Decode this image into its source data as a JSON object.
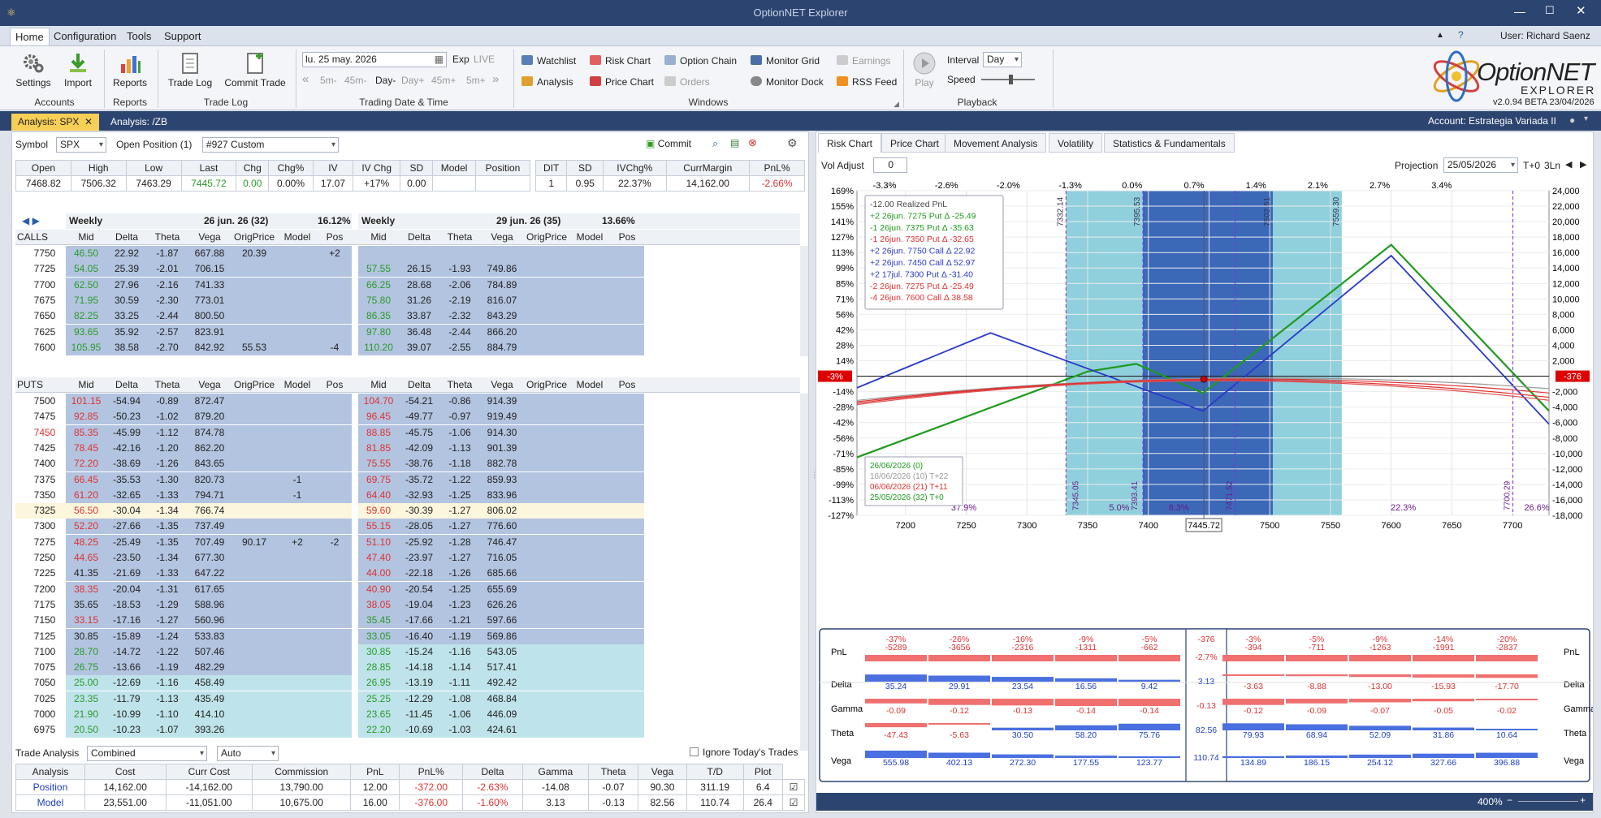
{
  "app": {
    "title": "OptionNET Explorer",
    "user": "User: Richard Saenz",
    "version": "v2.0.94 BETA 23/04/2026",
    "logo_main": "OptionNET",
    "logo_sub": "EXPLORER"
  },
  "menu": [
    "Home",
    "Configuration",
    "Tools",
    "Support"
  ],
  "ribbon": {
    "accounts": {
      "label": "Accounts",
      "buttons": [
        "Settings",
        "Import"
      ]
    },
    "reports": {
      "label": "Reports",
      "buttons": [
        "Reports"
      ]
    },
    "tradelog": {
      "label": "Trade Log",
      "buttons": [
        "Trade Log",
        "Commit Trade"
      ]
    },
    "trading": {
      "label": "Trading Date & Time",
      "date": "lu. 25 may. 2026",
      "exp": "Exp",
      "live": "LIVE",
      "steps": [
        "5m-",
        "45m-",
        "Day-",
        "Day+",
        "45m+",
        "5m+"
      ]
    },
    "windows": {
      "label": "Windows",
      "items": [
        "Watchlist",
        "Risk Chart",
        "Option Chain",
        "Monitor Grid",
        "Earnings",
        "Analysis",
        "Price Chart",
        "Orders",
        "Monitor Dock",
        "RSS Feed"
      ]
    },
    "playback": {
      "label": "Playback",
      "play": "Play",
      "interval_label": "Interval",
      "interval": "Day",
      "speed_label": "Speed"
    }
  },
  "doctabs": [
    "Analysis: SPX",
    "Analysis: /ZB"
  ],
  "account": "Account: Estrategia Variada II",
  "left": {
    "symbol_label": "Symbol",
    "symbol": "SPX",
    "open_pos_label": "Open Position (1)",
    "position": "#927 Custom",
    "commit": "Commit",
    "quote_headers": [
      "Open",
      "High",
      "Low",
      "Last",
      "Chg",
      "Chg%",
      "IV",
      "IV Chg",
      "SD",
      "Model",
      "Position"
    ],
    "quote_values": [
      "7468.82",
      "7506.32",
      "7463.29",
      "7445.72",
      "0.00",
      "0.00%",
      "17.07",
      "+17%",
      "0.00",
      "",
      ""
    ],
    "pos_headers": [
      "DIT",
      "SD",
      "IVChg%",
      "CurrMargin",
      "PnL%"
    ],
    "pos_values": [
      "1",
      "0.95",
      "22.37%",
      "14,162.00",
      "-2.66%"
    ],
    "exp1": {
      "name": "Weekly",
      "date": "26 jun. 26 (32)",
      "iv": "16.12%"
    },
    "exp2": {
      "name": "Weekly",
      "date": "29 jun. 26 (35)",
      "iv": "13.66%"
    },
    "chain_cols": [
      "Mid",
      "Delta",
      "Theta",
      "Vega",
      "OrigPrice",
      "Model",
      "Pos"
    ],
    "calls_label": "CALLS",
    "puts_label": "PUTS",
    "calls": [
      [
        "7750",
        "46.50",
        "22.92",
        "-1.87",
        "667.88",
        "20.39",
        "",
        "+2",
        "",
        "",
        "",
        "",
        "",
        "",
        ""
      ],
      [
        "7725",
        "54.05",
        "25.39",
        "-2.01",
        "706.15",
        "",
        "",
        "",
        "57.55",
        "26.15",
        "-1.93",
        "749.86",
        "",
        "",
        ""
      ],
      [
        "7700",
        "62.50",
        "27.96",
        "-2.16",
        "741.33",
        "",
        "",
        "",
        "66.25",
        "28.68",
        "-2.06",
        "784.89",
        "",
        "",
        ""
      ],
      [
        "7675",
        "71.95",
        "30.59",
        "-2.30",
        "773.01",
        "",
        "",
        "",
        "75.80",
        "31.26",
        "-2.19",
        "816.07",
        "",
        "",
        ""
      ],
      [
        "7650",
        "82.25",
        "33.25",
        "-2.44",
        "800.50",
        "",
        "",
        "",
        "86.35",
        "33.87",
        "-2.32",
        "843.29",
        "",
        "",
        ""
      ],
      [
        "7625",
        "93.65",
        "35.92",
        "-2.57",
        "823.91",
        "",
        "",
        "",
        "97.80",
        "36.48",
        "-2.44",
        "866.20",
        "",
        "",
        ""
      ],
      [
        "7600",
        "105.95",
        "38.58",
        "-2.70",
        "842.92",
        "55.53",
        "",
        "-4",
        "110.20",
        "39.07",
        "-2.55",
        "884.79",
        "",
        "",
        ""
      ]
    ],
    "puts": [
      [
        "7500",
        "101.15",
        "-54.94",
        "-0.89",
        "872.47",
        "",
        "",
        "",
        "104.70",
        "-54.21",
        "-0.86",
        "914.39",
        "",
        "",
        ""
      ],
      [
        "7475",
        "92.85",
        "-50.23",
        "-1.02",
        "879.20",
        "",
        "",
        "",
        "96.45",
        "-49.77",
        "-0.97",
        "919.49",
        "",
        "",
        ""
      ],
      [
        "7450",
        "85.35",
        "-45.99",
        "-1.12",
        "874.78",
        "",
        "",
        "",
        "88.85",
        "-45.75",
        "-1.06",
        "914.30",
        "",
        "",
        ""
      ],
      [
        "7425",
        "78.45",
        "-42.16",
        "-1.20",
        "862.20",
        "",
        "",
        "",
        "81.85",
        "-42.09",
        "-1.13",
        "901.39",
        "",
        "",
        ""
      ],
      [
        "7400",
        "72.20",
        "-38.69",
        "-1.26",
        "843.65",
        "",
        "",
        "",
        "75.55",
        "-38.76",
        "-1.18",
        "882.78",
        "",
        "",
        ""
      ],
      [
        "7375",
        "66.45",
        "-35.53",
        "-1.30",
        "820.73",
        "",
        "-1",
        "",
        "69.75",
        "-35.72",
        "-1.22",
        "859.93",
        "",
        "",
        ""
      ],
      [
        "7350",
        "61.20",
        "-32.65",
        "-1.33",
        "794.71",
        "",
        "-1",
        "",
        "64.40",
        "-32.93",
        "-1.25",
        "833.96",
        "",
        "",
        ""
      ],
      [
        "7325",
        "56.50",
        "-30.04",
        "-1.34",
        "766.74",
        "",
        "",
        "",
        "59.60",
        "-30.39",
        "-1.27",
        "806.02",
        "",
        "",
        ""
      ],
      [
        "7300",
        "52.20",
        "-27.66",
        "-1.35",
        "737.49",
        "",
        "",
        "",
        "55.15",
        "-28.05",
        "-1.27",
        "776.60",
        "",
        "",
        ""
      ],
      [
        "7275",
        "48.25",
        "-25.49",
        "-1.35",
        "707.49",
        "90.17",
        "+2",
        "-2",
        "51.10",
        "-25.92",
        "-1.28",
        "746.47",
        "",
        "",
        ""
      ],
      [
        "7250",
        "44.65",
        "-23.50",
        "-1.34",
        "677.30",
        "",
        "",
        "",
        "47.40",
        "-23.97",
        "-1.27",
        "716.05",
        "",
        "",
        ""
      ],
      [
        "7225",
        "41.35",
        "-21.69",
        "-1.33",
        "647.22",
        "",
        "",
        "",
        "44.00",
        "-22.18",
        "-1.26",
        "685.66",
        "",
        "",
        ""
      ],
      [
        "7200",
        "38.35",
        "-20.04",
        "-1.31",
        "617.65",
        "",
        "",
        "",
        "40.90",
        "-20.54",
        "-1.25",
        "655.69",
        "",
        "",
        ""
      ],
      [
        "7175",
        "35.65",
        "-18.53",
        "-1.29",
        "588.96",
        "",
        "",
        "",
        "38.05",
        "-19.04",
        "-1.23",
        "626.26",
        "",
        "",
        ""
      ],
      [
        "7150",
        "33.15",
        "-17.16",
        "-1.27",
        "560.96",
        "",
        "",
        "",
        "35.45",
        "-17.66",
        "-1.21",
        "597.66",
        "",
        "",
        ""
      ],
      [
        "7125",
        "30.85",
        "-15.89",
        "-1.24",
        "533.83",
        "",
        "",
        "",
        "33.05",
        "-16.40",
        "-1.19",
        "569.86",
        "",
        "",
        ""
      ],
      [
        "7100",
        "28.70",
        "-14.72",
        "-1.22",
        "507.46",
        "",
        "",
        "",
        "30.85",
        "-15.24",
        "-1.16",
        "543.05",
        "",
        "",
        ""
      ],
      [
        "7075",
        "26.75",
        "-13.66",
        "-1.19",
        "482.29",
        "",
        "",
        "",
        "28.85",
        "-14.18",
        "-1.14",
        "517.41",
        "",
        "",
        ""
      ],
      [
        "7050",
        "25.00",
        "-12.69",
        "-1.16",
        "458.49",
        "",
        "",
        "",
        "26.95",
        "-13.19",
        "-1.11",
        "492.42",
        "",
        "",
        ""
      ],
      [
        "7025",
        "23.35",
        "-11.79",
        "-1.13",
        "435.49",
        "",
        "",
        "",
        "25.25",
        "-12.29",
        "-1.08",
        "468.84",
        "",
        "",
        ""
      ],
      [
        "7000",
        "21.90",
        "-10.99",
        "-1.10",
        "414.10",
        "",
        "",
        "",
        "23.65",
        "-11.45",
        "-1.06",
        "446.09",
        "",
        "",
        ""
      ],
      [
        "6975",
        "20.50",
        "-10.23",
        "-1.07",
        "393.26",
        "",
        "",
        "",
        "22.20",
        "-10.69",
        "-1.03",
        "424.61",
        "",
        "",
        ""
      ]
    ],
    "trade_analysis": {
      "label": "Trade Analysis",
      "mode": "Combined",
      "auto": "Auto",
      "ignore": "Ignore Today's Trades",
      "headers": [
        "Analysis",
        "Cost",
        "Curr Cost",
        "Commission",
        "PnL",
        "PnL%",
        "Delta",
        "Gamma",
        "Theta",
        "Vega",
        "T/D",
        "Plot"
      ],
      "rows": [
        [
          "Position",
          "14,162.00",
          "-14,162.00",
          "13,790.00",
          "12.00",
          "-372.00",
          "-2.63%",
          "-14.08",
          "-0.07",
          "90.30",
          "311.19",
          "6.4"
        ],
        [
          "Model",
          "23,551.00",
          "-11,051.00",
          "10,675.00",
          "16.00",
          "-376.00",
          "-1.60%",
          "3.13",
          "-0.13",
          "82.56",
          "110.74",
          "26.4"
        ]
      ]
    }
  },
  "right": {
    "tabs": [
      "Risk Chart",
      "Price Chart",
      "Movement Analysis",
      "Volatility",
      "Statistics & Fundamentals"
    ],
    "vol_adjust_label": "Vol Adjust",
    "vol_adjust": "0",
    "projection_label": "Projection",
    "projection": "25/05/2026",
    "t0": "T+0",
    "ln": "3Ln",
    "zoom": "400%",
    "legend": [
      "-12.00 Realized PnL",
      "+2 26jun. 7275 Put Δ  -25.49",
      "-1 26jun. 7375 Put Δ  -35.63",
      "-1 26jun. 7350 Put Δ  -32.65",
      "+2 26jun. 7750 Call Δ  22.92",
      "+2 26jun. 7450 Call Δ  52.97",
      "+2 17jul. 7300 Put Δ  -31.40",
      "-2 26jun. 7275 Put Δ  -25.49",
      "-4 26jun. 7600 Call Δ  38.58"
    ],
    "curve_legend": [
      "26/06/2026 (0)",
      "16/06/2026 (10) T+22",
      "06/06/2026 (21) T+11",
      "25/05/2026 (32) T+0"
    ],
    "pct_top": [
      "-3.3%",
      "-2.6%",
      "-2.0%",
      "-1.3%",
      "0.0%",
      "0.7%",
      "1.4%",
      "2.1%",
      "2.7%",
      "3.4%"
    ],
    "pct_left": [
      "169%",
      "155%",
      "141%",
      "127%",
      "113%",
      "99%",
      "85%",
      "71%",
      "56%",
      "42%",
      "28%",
      "14%",
      "-14%",
      "-28%",
      "-42%",
      "-56%",
      "-71%",
      "-85%",
      "-99%",
      "-113%",
      "-127%"
    ],
    "pnl_right": [
      "24,000",
      "22,000",
      "20,000",
      "18,000",
      "16,000",
      "14,000",
      "12,000",
      "10,000",
      "8,000",
      "6,000",
      "4,000",
      "2,000",
      "-2,000",
      "-4,000",
      "-6,000",
      "-8,000",
      "-10,000",
      "-12,000",
      "-14,000",
      "-16,000",
      "-18,000"
    ],
    "x_ticks": [
      "7200",
      "7250",
      "7300",
      "7350",
      "7400",
      "7450",
      "7500",
      "7550",
      "7600",
      "7650",
      "7700"
    ],
    "last": "7445.72",
    "cur_pct": "-3%",
    "cur_pnl": "-376",
    "vlines": [
      "7332.14",
      "7395.53",
      "7502.51",
      "7559.30",
      "7345.05",
      "7393.41",
      "7471.52",
      "7700.29"
    ],
    "zone_pct": [
      "37.9%",
      "5.0%",
      "8.3%",
      "22.3%",
      "26.6%"
    ],
    "greeks": {
      "pnl_pct": [
        "-37%",
        "-26%",
        "-16%",
        "-9%",
        "-5%",
        "-376",
        "-3%",
        "-5%",
        "-9%",
        "-14%",
        "-20%"
      ],
      "pnl": [
        "-5289",
        "-3656",
        "-2316",
        "-1311",
        "-662",
        "-2.7%",
        "-394",
        "-711",
        "-1263",
        "-1991",
        "-2837"
      ],
      "delta": [
        "35.24",
        "29.91",
        "23.54",
        "16.56",
        "9.42",
        "3.13",
        "-3.63",
        "-8.88",
        "-13.00",
        "-15.93",
        "-17.70"
      ],
      "gamma": [
        "-0.09",
        "-0.12",
        "-0.13",
        "-0.14",
        "-0.14",
        "-0.13",
        "-0.12",
        "-0.09",
        "-0.07",
        "-0.05",
        "-0.02"
      ],
      "theta": [
        "-47.43",
        "-5.63",
        "30.50",
        "58.20",
        "75.76",
        "82.56",
        "79.93",
        "68.94",
        "52.09",
        "31.86",
        "10.64"
      ],
      "vega": [
        "555.98",
        "402.13",
        "272.30",
        "177.55",
        "123.77",
        "110.74",
        "134.89",
        "186.15",
        "254.12",
        "327.66",
        "396.88"
      ],
      "labels": [
        "PnL",
        "Delta",
        "Gamma",
        "Theta",
        "Vega"
      ]
    },
    "colors": {
      "accent": "#2c4470",
      "green": "#1f9a1f",
      "blue": "#2b39c8",
      "red": "#e03030",
      "band": "#8fd0dc",
      "band_dark": "#3b69b8"
    }
  }
}
